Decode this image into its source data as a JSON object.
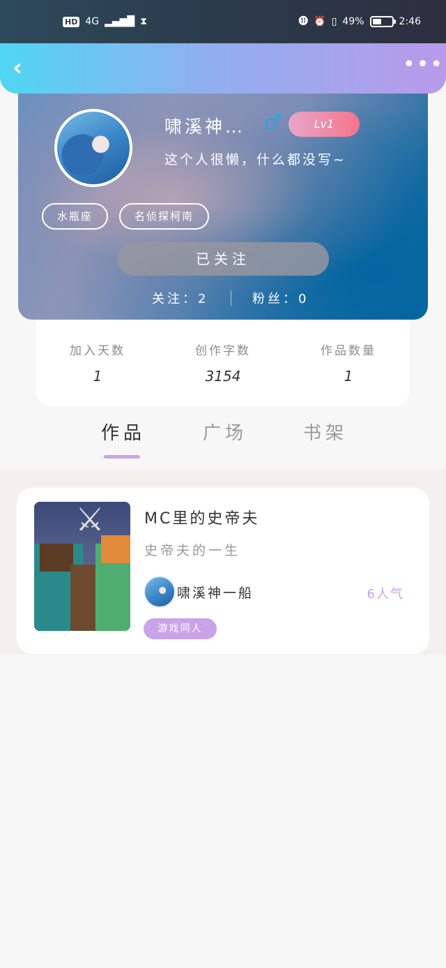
{
  "statusbar": {
    "hd": "HD",
    "network": "4G",
    "signal_icon": "signal-icon",
    "hourglass_icon": "hourglass-icon",
    "battery_percent": "49%",
    "battery_level": 0.49,
    "time": "2:46"
  },
  "header": {
    "back_icon": "chevron-left-icon",
    "more_icon": "more-dots-icon"
  },
  "profile": {
    "username": "啸溪神…",
    "gender_symbol": "♂",
    "level": "Lv1",
    "bio": "这个人很懒，什么都没写~",
    "tags": [
      "水瓶座",
      "名侦探柯南"
    ],
    "follow_button": "已关注",
    "following_text": "关注：2",
    "fans_text": "粉丝：0"
  },
  "stats": {
    "days_label": "加入天数",
    "days_value": "1",
    "words_label": "创作字数",
    "words_value": "3154",
    "works_label": "作品数量",
    "works_value": "1"
  },
  "tabs": [
    "作品",
    "广场",
    "书架"
  ],
  "active_tab": "作品",
  "work": {
    "title": "MC里的史帝夫",
    "description": "史帝夫的一生",
    "author": "啸溪神一船",
    "popularity": "6人气",
    "category": "游戏同人"
  },
  "colors": {
    "accent": "#c9a3e8",
    "header_start": "#4fd6f2",
    "header_end": "#b89aea",
    "level_badge": "#f4758a",
    "gender": "#2aa3e6"
  }
}
